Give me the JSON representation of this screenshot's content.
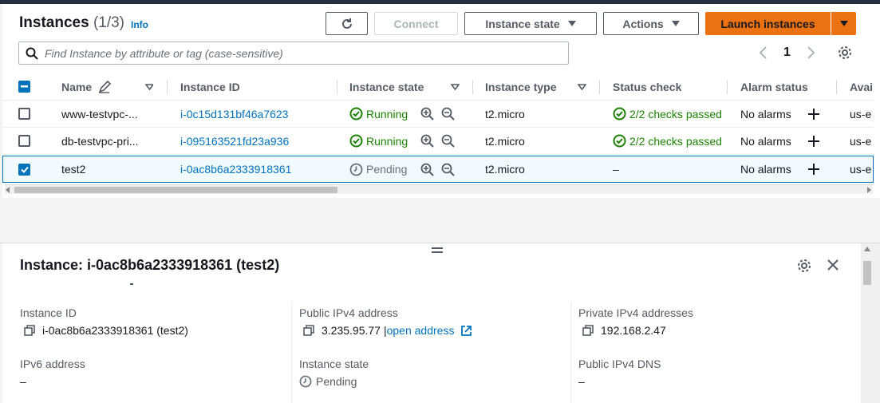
{
  "header": {
    "title": "Instances",
    "count": "(1/3)",
    "info": "Info"
  },
  "toolbar": {
    "connect": "Connect",
    "instance_state": "Instance state",
    "actions": "Actions",
    "launch": "Launch instances"
  },
  "search": {
    "placeholder": "Find Instance by attribute or tag (case-sensitive)"
  },
  "pagination": {
    "page": "1"
  },
  "table": {
    "columns": [
      "Name",
      "Instance ID",
      "Instance state",
      "Instance type",
      "Status check",
      "Alarm status",
      "Avai"
    ],
    "rows": [
      {
        "name": "www-testvpc-...",
        "id": "i-0c15d131bf46a7623",
        "state": "Running",
        "type": "t2.micro",
        "status": "2/2 checks passed",
        "alarm": "No alarms",
        "az": "us-e"
      },
      {
        "name": "db-testvpc-pri...",
        "id": "i-095163521fd23a936",
        "state": "Running",
        "type": "t2.micro",
        "status": "2/2 checks passed",
        "alarm": "No alarms",
        "az": "us-e"
      },
      {
        "name": "test2",
        "id": "i-0ac8b6a2333918361",
        "state": "Pending",
        "type": "t2.micro",
        "status": "–",
        "alarm": "No alarms",
        "az": "us-e"
      }
    ]
  },
  "detail": {
    "title": "Instance: i-0ac8b6a2333918361 (test2)",
    "fields": {
      "instance_id_label": "Instance ID",
      "instance_id_value": "i-0ac8b6a2333918361 (test2)",
      "public_ipv4_label": "Public IPv4 address",
      "public_ipv4_value": "3.235.95.77",
      "open_address": "open address",
      "private_ipv4_label": "Private IPv4 addresses",
      "private_ipv4_value": "192.168.2.47",
      "ipv6_label": "IPv6 address",
      "ipv6_value": "–",
      "instance_state_label": "Instance state",
      "instance_state_value": "Pending",
      "public_dns_label": "Public IPv4 DNS",
      "public_dns_value": "–"
    }
  },
  "colors": {
    "accent": "#0073bb",
    "primary": "#ec7211",
    "success": "#1d8102"
  }
}
